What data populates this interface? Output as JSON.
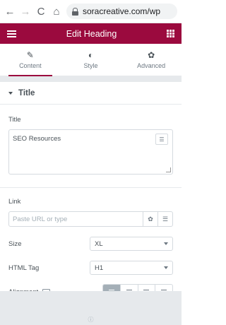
{
  "browser": {
    "back_glyph": "←",
    "forward_glyph": "→",
    "reload_glyph": "C",
    "home_glyph": "⌂",
    "url": "soracreative.com/wp"
  },
  "header": {
    "title": "Edit Heading",
    "bg_color": "#9b0a3e"
  },
  "tabs": [
    {
      "label": "Content",
      "icon": "pencil-icon",
      "glyph": "✎",
      "active": true
    },
    {
      "label": "Style",
      "icon": "contrast-icon",
      "glyph": "◐",
      "active": false
    },
    {
      "label": "Advanced",
      "icon": "gear-icon",
      "glyph": "✿",
      "active": false
    }
  ],
  "section": {
    "title": "Title",
    "title_field_label": "Title",
    "title_value": "SEO Resources",
    "link_label": "Link",
    "link_placeholder": "Paste URL or type",
    "size_label": "Size",
    "size_value": "XL",
    "html_tag_label": "HTML Tag",
    "html_tag_value": "H1",
    "alignment_label": "Alignment"
  },
  "accent_color": "#9b0a3e"
}
